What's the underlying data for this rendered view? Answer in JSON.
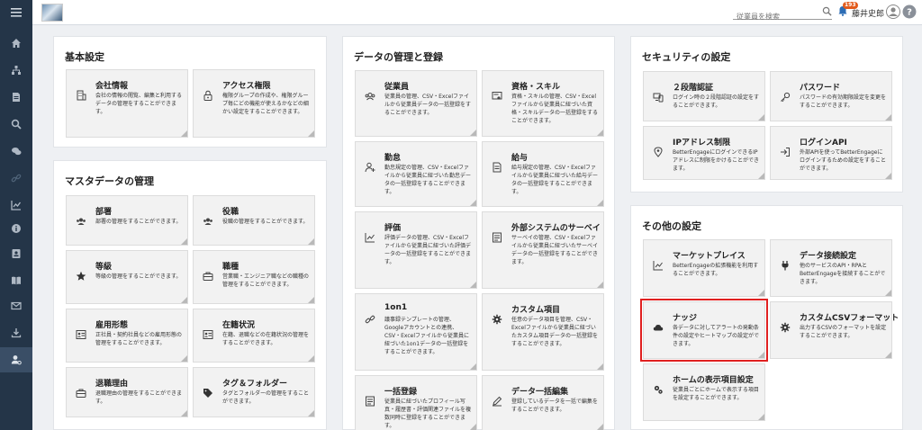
{
  "header": {
    "search_placeholder": "従業員を検索",
    "notification_count": "193",
    "user_name": "藤井史郎"
  },
  "sidebar": {
    "items": [
      "home-icon",
      "org-icon",
      "document-icon",
      "search-icon",
      "chat-icon",
      "link-icon",
      "chart-icon",
      "info-icon",
      "id-card-icon",
      "book-icon",
      "mail-icon",
      "download-icon",
      "user-settings-icon"
    ]
  },
  "panels": {
    "basic": {
      "title": "基本設定",
      "cards": [
        {
          "title": "会社情報",
          "desc": "会社の情報の閲覧、編集と利用する データの管理をすることができます。"
        },
        {
          "title": "アクセス権限",
          "desc": "権限グループの作成や、権限グループ毎にどの機能が使えるかなどの細かい設定をすることができます。"
        }
      ]
    },
    "master": {
      "title": "マスタデータの管理",
      "cards": [
        {
          "title": "部署",
          "desc": "部署の管理をすることができます。"
        },
        {
          "title": "役職",
          "desc": "役職の管理をすることができます。"
        },
        {
          "title": "等級",
          "desc": "等級の管理をすることができます。"
        },
        {
          "title": "職種",
          "desc": "営業職・エンジニア職などの職種の管理をすることができます。"
        },
        {
          "title": "雇用形態",
          "desc": "正社員・契約社員などの雇用形態の管理をすることができます。"
        },
        {
          "title": "在籍状況",
          "desc": "在籍、退職などの在籍状況の管理をすることができます。"
        },
        {
          "title": "退職理由",
          "desc": "退職理由の管理をすることができます。"
        },
        {
          "title": "タグ＆フォルダー",
          "desc": "タグとフォルダーの管理をすることができます。"
        }
      ]
    },
    "data": {
      "title": "データの管理と登録",
      "cards": [
        {
          "title": "従業員",
          "desc": "従業員の管理、CSV・Excelファイルから従業員データの一括登録をすることができます。"
        },
        {
          "title": "資格・スキル",
          "desc": "資格・スキルの管理、CSV・Excelファイルから従業員に紐づいた資格・スキルデータの一括登録をすることができます。"
        },
        {
          "title": "勤怠",
          "desc": "勤怠規定の管理、CSV・Excelファイルから従業員に紐づいた勤怠データの一括登録をすることができます。"
        },
        {
          "title": "給与",
          "desc": "給与規定の管理、CSV・Excelファイルから従業員に紐づいた給与データの一括登録をすることができます。"
        },
        {
          "title": "評価",
          "desc": "評価データの管理、CSV・Excelファイルから従業員に紐づいた評価データの一括登録をすることができます。"
        },
        {
          "title": "外部システムのサーベイ",
          "desc": "サーベイの管理、CSV・Excelファイルから従業員に紐づいたサーベイデータの一括登録をすることができます。"
        },
        {
          "title": "1on1",
          "desc": "議事録テンプレートの管理、Googleアカウントとの連携、CSV・Excelファイルから従業員に紐づいた1on1データの一括登録をすることができます。"
        },
        {
          "title": "カスタム項目",
          "desc": "任意のデータ項目を管理、CSV・Excelファイルから従業員に紐づいたカスタム項目データの一括登録をすることができます。"
        },
        {
          "title": "一括登録",
          "desc": "従業員に紐づいたプロフィール写真・履歴書・評価関連ファイルを複数同時に登録をすることができます。"
        },
        {
          "title": "データ一括編集",
          "desc": "登録しているデータを一括で編集をすることができます。"
        }
      ]
    },
    "security": {
      "title": "セキュリティの設定",
      "cards": [
        {
          "title": "２段階認証",
          "desc": "ログイン時の２段階認証の設定をすることができます。"
        },
        {
          "title": "パスワード",
          "desc": "パスワードの有効期限設定を変更をすることができます。"
        },
        {
          "title": "IPアドレス制限",
          "desc": "BetterEngageにログインできるIPアドレスに制限をかけることができます。"
        },
        {
          "title": "ログインAPI",
          "desc": "外部APIを使ってBetterEngageにログインするための設定をすることができます。"
        }
      ]
    },
    "other": {
      "title": "その他の設定",
      "cards": [
        {
          "title": "マーケットプレイス",
          "desc": "BetterEngageの拡張機能を利用することができます。"
        },
        {
          "title": "データ接続設定",
          "desc": "他のサービスのAPI・RPAとBetterEngageを接続することができます。"
        },
        {
          "title": "ナッジ",
          "desc": "各データに対してアラートの発動条件の設定やヒートマップの設定ができます。"
        },
        {
          "title": "カスタムCSVフォーマット",
          "desc": "出力するCSVのフォーマットを設定することができます。"
        },
        {
          "title": "ホームの表示項目設定",
          "desc": "従業員ごとにホームで表示する項目を設定することができます。"
        }
      ]
    }
  },
  "colors": {
    "sidebar": "#243548",
    "highlight": "#e02020",
    "badge": "#e35b1c"
  }
}
